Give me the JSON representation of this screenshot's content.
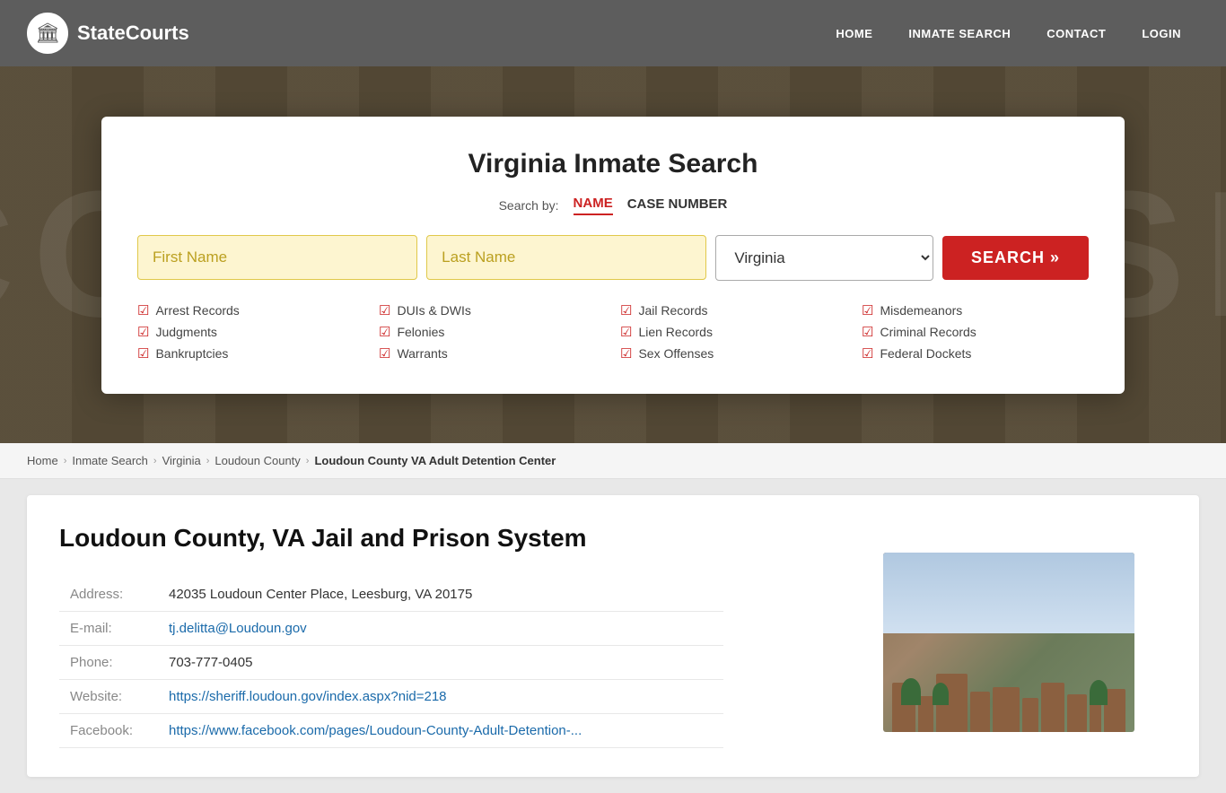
{
  "navbar": {
    "logo_text": "StateCourts",
    "logo_icon": "🏛",
    "links": [
      {
        "label": "HOME",
        "href": "#"
      },
      {
        "label": "INMATE SEARCH",
        "href": "#"
      },
      {
        "label": "CONTACT",
        "href": "#"
      },
      {
        "label": "LOGIN",
        "href": "#"
      }
    ]
  },
  "hero_bg_text": "COURTHOUSE",
  "search_card": {
    "title": "Virginia Inmate Search",
    "search_by_label": "Search by:",
    "tabs": [
      {
        "label": "NAME",
        "active": true
      },
      {
        "label": "CASE NUMBER",
        "active": false
      }
    ],
    "first_name_placeholder": "First Name",
    "last_name_placeholder": "Last Name",
    "state_value": "Virginia",
    "search_button_label": "SEARCH »",
    "features": [
      "Arrest Records",
      "DUIs & DWIs",
      "Jail Records",
      "Misdemeanors",
      "Judgments",
      "Felonies",
      "Lien Records",
      "Criminal Records",
      "Bankruptcies",
      "Warrants",
      "Sex Offenses",
      "Federal Dockets"
    ]
  },
  "breadcrumb": {
    "items": [
      {
        "label": "Home",
        "href": "#"
      },
      {
        "label": "Inmate Search",
        "href": "#"
      },
      {
        "label": "Virginia",
        "href": "#"
      },
      {
        "label": "Loudoun County",
        "href": "#"
      },
      {
        "label": "Loudoun County VA Adult Detention Center",
        "current": true
      }
    ]
  },
  "content": {
    "title": "Loudoun County, VA Jail and Prison System",
    "fields": [
      {
        "label": "Address:",
        "value": "42035 Loudoun Center Place, Leesburg, VA 20175",
        "link": false
      },
      {
        "label": "E-mail:",
        "value": "tj.delitta@Loudoun.gov",
        "link": true
      },
      {
        "label": "Phone:",
        "value": "703-777-0405",
        "link": false
      },
      {
        "label": "Website:",
        "value": "https://sheriff.loudoun.gov/index.aspx?nid=218",
        "link": true
      },
      {
        "label": "Facebook:",
        "value": "https://www.facebook.com/pages/Loudoun-County-Adult-Detention-...",
        "link": true
      }
    ]
  }
}
